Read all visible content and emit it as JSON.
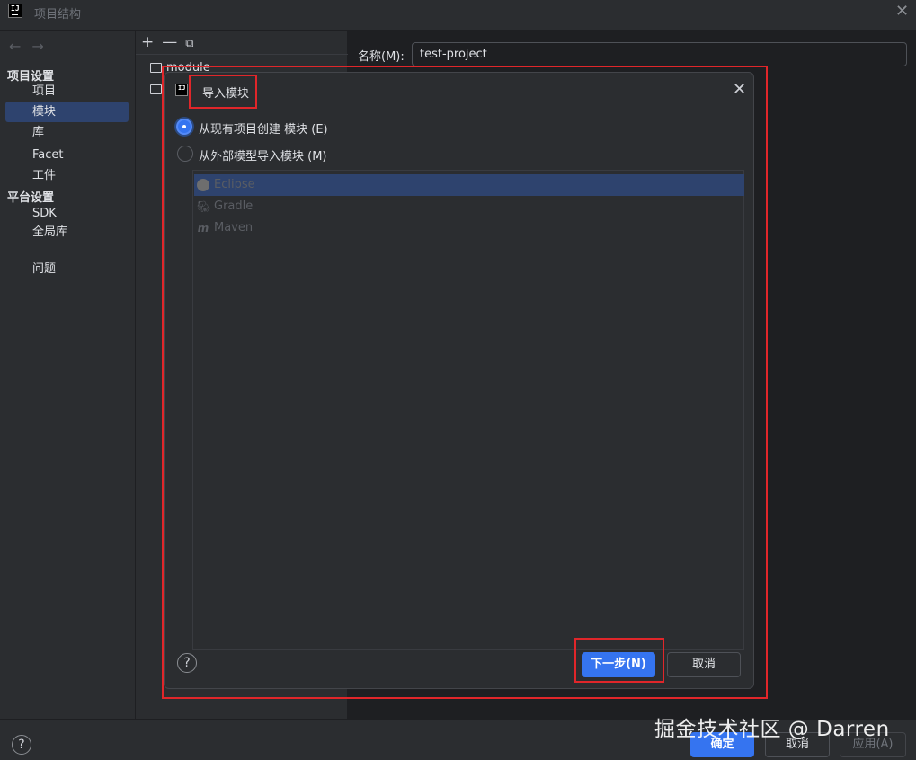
{
  "window": {
    "title": "项目结构",
    "close_glyph": "✕"
  },
  "nav": {
    "back": "←",
    "forward": "→"
  },
  "sidebar": {
    "project_settings_heading": "项目设置",
    "platform_settings_heading": "平台设置",
    "items": [
      {
        "label": "项目"
      },
      {
        "label": "模块",
        "selected": true
      },
      {
        "label": "库"
      },
      {
        "label": "Facet"
      },
      {
        "label": "工件"
      },
      {
        "label": "SDK"
      },
      {
        "label": "全局库"
      },
      {
        "label": "问题"
      }
    ]
  },
  "module_tree": {
    "toolbar": {
      "add": "+",
      "remove": "—",
      "copy": "⧉"
    },
    "items": [
      {
        "label": "module"
      }
    ]
  },
  "details": {
    "name_label": "名称(M):",
    "name_value": "test-project"
  },
  "dialog": {
    "title": "导入模块",
    "close_glyph": "✕",
    "options": [
      {
        "label": "从现有项目创建 模块 (E)",
        "checked": true
      },
      {
        "label": "从外部模型导入模块 (M)",
        "checked": false
      }
    ],
    "models": [
      {
        "label": "Eclipse",
        "icon": "eclipse-icon",
        "selected": true
      },
      {
        "label": "Gradle",
        "icon": "gradle-icon",
        "selected": false
      },
      {
        "label": "Maven",
        "icon": "maven-icon",
        "selected": false
      }
    ],
    "help_glyph": "?",
    "next_button": "下一步(N)",
    "cancel_button": "取消"
  },
  "footer": {
    "help_glyph": "?",
    "ok_button": "确定",
    "cancel_button": "取消",
    "apply_button": "应用(A)"
  },
  "watermark": "掘金技术社区 @ Darren",
  "colors": {
    "accent": "#3574f0",
    "selection": "#2e436e",
    "highlight_box": "#e0262a",
    "background": "#1e1f22",
    "panel": "#2b2d30"
  }
}
